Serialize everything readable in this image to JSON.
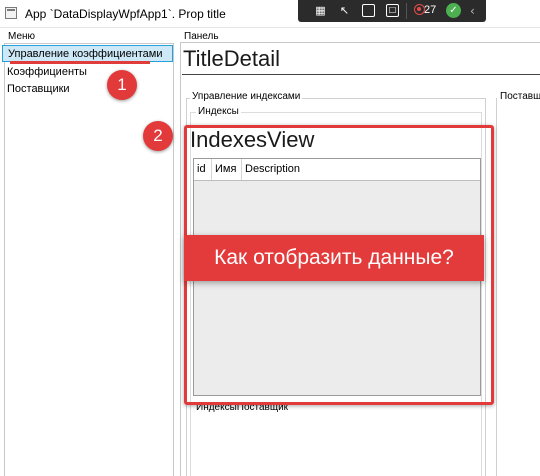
{
  "window": {
    "title": "App `DataDisplayWpfApp1`. Prop title"
  },
  "devtools": {
    "error_count": "27"
  },
  "menu": {
    "group_label": "Меню",
    "items": [
      {
        "label": "Управление коэффициентами",
        "selected": true
      },
      {
        "label": "Коэффициенты",
        "selected": false
      },
      {
        "label": "Поставщики",
        "selected": false
      }
    ]
  },
  "panel": {
    "group_label": "Панель",
    "title": "TitleDetail",
    "indexes_group_label": "Управление индексами",
    "suppliers_label": "Поставщ",
    "indexes_sub_label": "Индексы",
    "view_title": "IndexesView",
    "grid": {
      "columns": [
        "id",
        "Имя",
        "Description"
      ]
    },
    "bottom_label": "ИндексыПоставщик"
  },
  "annotations": {
    "badge_1": "1",
    "badge_2": "2",
    "banner": "Как отобразить данные?"
  },
  "colors": {
    "accent_red": "#e33b3b",
    "selection_fill": "#cde8f6",
    "selection_border": "#26a0da",
    "grid_background": "#ececec"
  }
}
